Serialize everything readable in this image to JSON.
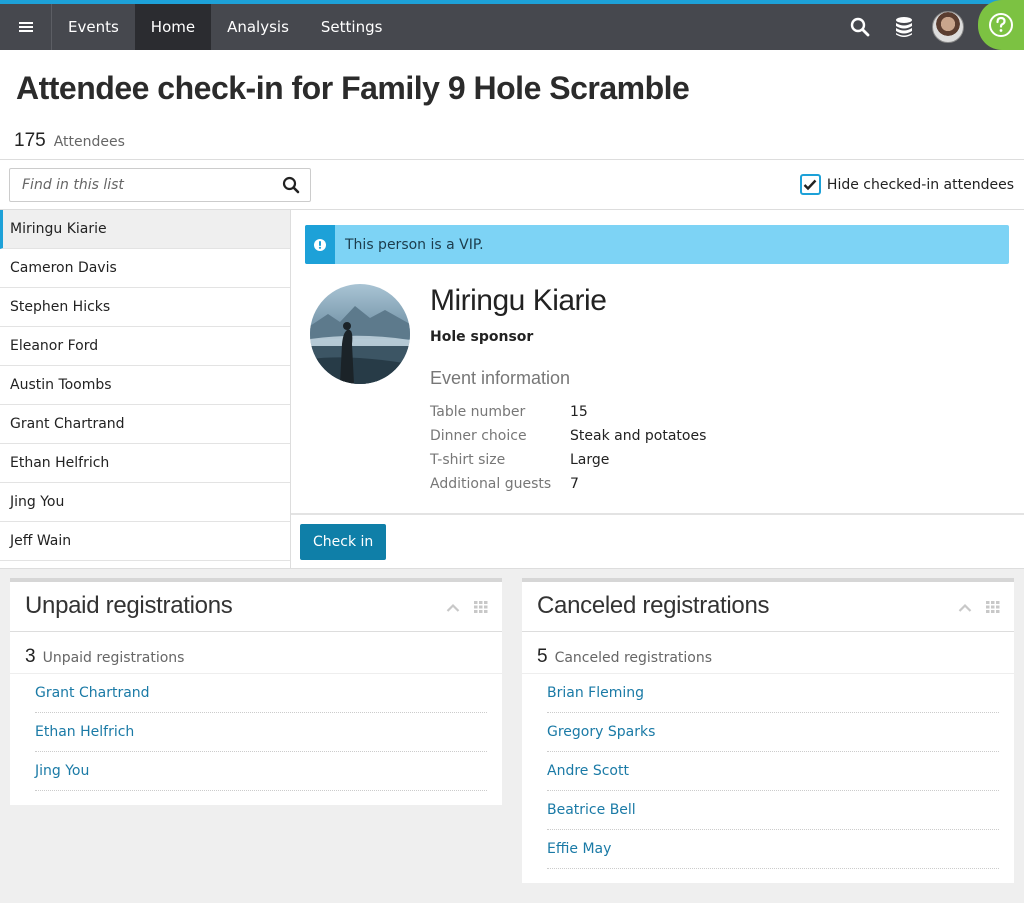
{
  "nav": {
    "items": [
      {
        "label": "Events",
        "active": false
      },
      {
        "label": "Home",
        "active": true
      },
      {
        "label": "Analysis",
        "active": false
      },
      {
        "label": "Settings",
        "active": false
      }
    ]
  },
  "page": {
    "title": "Attendee check-in for Family 9 Hole Scramble",
    "attendee_count": "175",
    "attendee_label": "Attendees"
  },
  "filter": {
    "search_placeholder": "Find in this list",
    "hide_label": "Hide checked-in attendees",
    "hide_checked": true
  },
  "attendees": [
    "Miringu Kiarie",
    "Cameron Davis",
    "Stephen Hicks",
    "Eleanor Ford",
    "Austin Toombs",
    "Grant Chartrand",
    "Ethan Helfrich",
    "Jing You",
    "Jeff Wain"
  ],
  "detail": {
    "vip_message": "This person is a VIP.",
    "name": "Miringu Kiarie",
    "role": "Hole sponsor",
    "event_info_heading": "Event information",
    "fields": [
      {
        "key": "Table number",
        "value": "15"
      },
      {
        "key": "Dinner choice",
        "value": "Steak and potatoes"
      },
      {
        "key": "T-shirt size",
        "value": "Large"
      },
      {
        "key": "Additional guests",
        "value": "7"
      }
    ],
    "checkin_label": "Check in"
  },
  "unpaid": {
    "title": "Unpaid registrations",
    "count": "3",
    "count_label": "Unpaid registrations",
    "items": [
      "Grant Chartrand",
      "Ethan Helfrich",
      "Jing You"
    ]
  },
  "canceled": {
    "title": "Canceled registrations",
    "count": "5",
    "count_label": "Canceled registrations",
    "items": [
      "Brian Fleming",
      "Gregory Sparks",
      "Andre Scott",
      "Beatrice Bell",
      "Effie May"
    ]
  },
  "colors": {
    "accent": "#1da1d8",
    "topbar": "#46484e",
    "help": "#7cc242",
    "button": "#0f7fa8",
    "vip_bg": "#7dd3f5",
    "link": "#1a7aa6"
  }
}
